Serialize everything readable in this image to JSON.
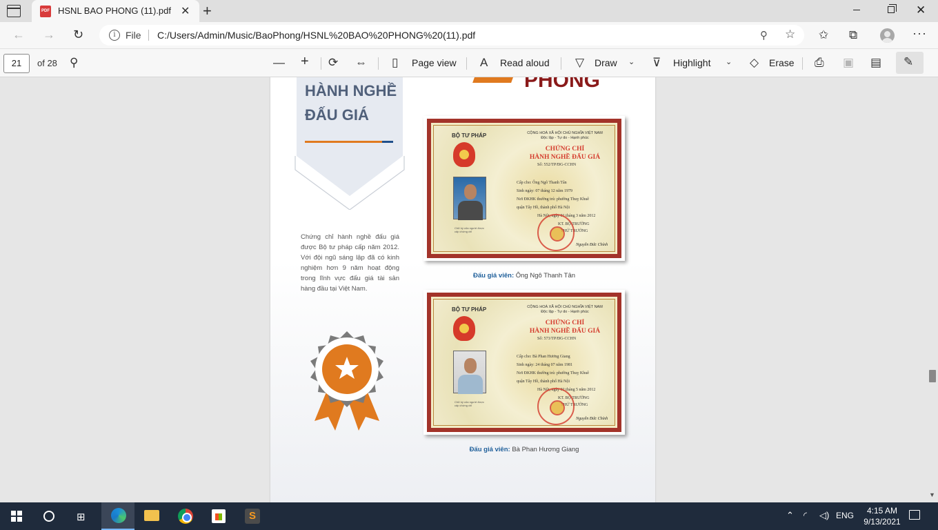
{
  "browser": {
    "tab_title": "HSNL BAO PHONG (11).pdf",
    "url_scheme_label": "File",
    "url": "C:/Users/Admin/Music/BaoPhong/HSNL%20BAO%20PHONG%20(11).pdf"
  },
  "pdf_toolbar": {
    "page_number": "21",
    "page_total": "of 28",
    "page_view_label": "Page view",
    "read_aloud_label": "Read aloud",
    "draw_label": "Draw",
    "highlight_label": "Highlight",
    "erase_label": "Erase"
  },
  "document": {
    "section_title_line1": "HÀNH NGHỀ",
    "section_title_line2": "ĐẤU GIÁ",
    "brand_text": "PHONG",
    "description": "Chứng chỉ hành nghề đấu giá được Bộ tư pháp cấp năm 2012. Với đội ngũ sáng lập đã có kinh nghiệm hơn 9 năm hoạt động trong lĩnh vực đấu giá tài sản hàng đầu tại Việt Nam.",
    "certificates": [
      {
        "ministry": "BỘ TƯ PHÁP",
        "header": "CỘNG HOÀ XÃ HỘI CHỦ NGHĨA VIỆT NAM",
        "motto": "Độc lập - Tự do - Hạnh phúc",
        "title_line1": "CHỨNG CHỈ",
        "title_line2": "HÀNH NGHỀ ĐẤU GIÁ",
        "number": "Số: 552/TP/ĐG-CCHN",
        "holder": "Cấp cho: Ông Ngô Thanh Tân",
        "birth": "Sinh ngày: 07 tháng 12 năm 1979",
        "residence": "Nơi ĐKHK thường trú: phường Thuỵ Khuê",
        "district": "quận Tây Hồ, thành phố Hà Nội",
        "issued": "Hà Nội, ngày 01 tháng 3 năm 2012",
        "sign_title": "KT. BỘ TRƯỞNG",
        "sign_title2": "THỨ TRƯỞNG",
        "signer": "Nguyễn Đức Chính",
        "note": "Chữ ký của người được cấp chứng chỉ",
        "caption_label": "Đấu giá viên:",
        "caption_name": "Ông Ngô Thanh Tân"
      },
      {
        "ministry": "BỘ TƯ PHÁP",
        "header": "CỘNG HOÀ XÃ HỘI CHỦ NGHĨA VIỆT NAM",
        "motto": "Độc lập - Tự do - Hạnh phúc",
        "title_line1": "CHỨNG CHỈ",
        "title_line2": "HÀNH NGHỀ ĐẤU GIÁ",
        "number": "Số: 573/TP/ĐG-CCHN",
        "holder": "Cấp cho: Bà Phan Hương Giang",
        "birth": "Sinh ngày: 24 tháng 07 năm 1981",
        "residence": "Nơi ĐKHK thường trú: phường Thuỵ Khuê",
        "district": "quận Tây Hồ, thành phố Hà Nội",
        "issued": "Hà Nội, ngày 02 tháng 5 năm 2012",
        "sign_title": "KT. BỘ TRƯỞNG",
        "sign_title2": "THỨ TRƯỞNG",
        "signer": "Nguyễn Đức Chính",
        "note": "Chữ ký của người được cấp chứng chỉ",
        "caption_label": "Đấu giá viên:",
        "caption_name": "Bà Phan Hương Giang"
      }
    ]
  },
  "taskbar": {
    "language": "ENG",
    "time": "4:15 AM",
    "date": "9/13/2021"
  },
  "colors": {
    "accent_orange": "#e07a1f",
    "heading_slate": "#50607a",
    "cert_red": "#a3332a",
    "caption_blue": "#1f5f9a",
    "taskbar": "#1f2b3c"
  }
}
